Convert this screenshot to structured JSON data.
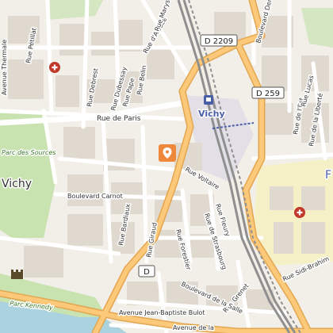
{
  "map": {
    "colors": {
      "background": "#f2efe9",
      "block": "#e0d9cf",
      "street": "#ffffff",
      "primary_road": "#fcc97b",
      "primary_road_casing": "#e3a64f",
      "railway": "#8f8f8f",
      "park": "#c8e3b0",
      "water": "#aad3df",
      "hospital": "#c0392b",
      "hospital_area": "#f6f0c6",
      "poi_marker": "#f0883c",
      "station_area": "#d9d3e6",
      "station_label": "#4a5ea8",
      "town_label": "#333333"
    },
    "places": [
      {
        "id": "vichy-west",
        "text": "Vichy"
      },
      {
        "id": "vichy-station",
        "text": "Vichy"
      },
      {
        "id": "parc-des-sources",
        "text": "Parc des Sources"
      },
      {
        "id": "parc-kennedy",
        "text": "Parc Kennedy"
      },
      {
        "id": "edge-f",
        "text": "F"
      }
    ],
    "road_refs": [
      {
        "id": "d2209",
        "text": "D 2209"
      },
      {
        "id": "d259",
        "text": "D 259"
      },
      {
        "id": "d-lower",
        "text": "D"
      }
    ],
    "streets": [
      {
        "id": "avenue-thermale",
        "text": "Avenue Thermale"
      },
      {
        "id": "rue-petillat",
        "text": "Rue Pétillat"
      },
      {
        "id": "rue-de-paris",
        "text": "Rue de Paris"
      },
      {
        "id": "rue-debrest",
        "text": "Rue Debrest"
      },
      {
        "id": "rue-dubessay",
        "text": "Rue Dubessay"
      },
      {
        "id": "rue-belin",
        "text": "Rue Belin"
      },
      {
        "id": "rue-pape",
        "text": "Rue Pape"
      },
      {
        "id": "rue-d-alsace",
        "text": "Rue d'Alsace"
      },
      {
        "id": "rue-maryse",
        "text": "Rue Maryse"
      },
      {
        "id": "boulevard-denière",
        "text": "Boulevard Denière"
      },
      {
        "id": "boulevard-carnot",
        "text": "Boulevard Carnot"
      },
      {
        "id": "rue-voltaire",
        "text": "Rue Voltaire"
      },
      {
        "id": "rue-de-la-liberte",
        "text": "Rue de la Liberté"
      },
      {
        "id": "rue-de-l-est",
        "text": "Rue de l'Est"
      },
      {
        "id": "rue-lucas",
        "text": "Rue Lucas"
      },
      {
        "id": "rue-bardiaux",
        "text": "Rue Bardiaux"
      },
      {
        "id": "rue-giraud",
        "text": "Rue Giraud"
      },
      {
        "id": "rue-forestier",
        "text": "Rue Forestier"
      },
      {
        "id": "rue-de-strasbourg",
        "text": "Rue de Strasbourg"
      },
      {
        "id": "rue-fleury",
        "text": "Rue Fleury"
      },
      {
        "id": "rue-grenet",
        "text": "Rue Grenet"
      },
      {
        "id": "rue-sidi-brahim",
        "text": "Rue Sidi-Brahim"
      },
      {
        "id": "boulevard-de-la-salle",
        "text": "Boulevard de la Salle"
      },
      {
        "id": "avenue-jean-baptiste-bulot",
        "text": "Avenue Jean-Baptiste Bulot"
      },
      {
        "id": "avenue-de-la",
        "text": "Avenue de la"
      }
    ]
  }
}
